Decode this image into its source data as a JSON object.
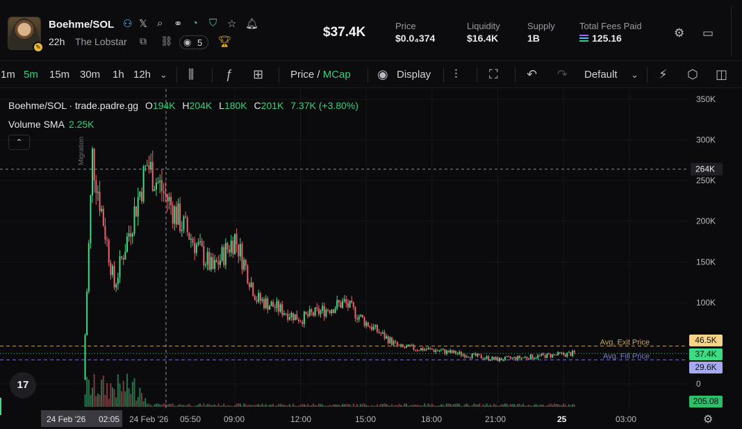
{
  "header": {
    "pair": "Boehme/SOL",
    "age": "22h",
    "creator": "The Lobstar",
    "watchers": "5",
    "market_cap": "$37.4K",
    "stats": [
      {
        "label": "Price",
        "value": "$0.0₄374"
      },
      {
        "label": "Liquidity",
        "value": "$16.4K"
      },
      {
        "label": "Supply",
        "value": "1B"
      },
      {
        "label": "Total Fees Paid",
        "value": "125.16"
      }
    ],
    "icons": [
      "community-icon",
      "x-icon",
      "search-icon",
      "link-icon",
      "pie-icon",
      "shield-icon",
      "star-icon",
      "bell-icon",
      "copy-icon",
      "chain-icon",
      "eye-icon",
      "trophy-icon",
      "settings-icon",
      "layout-icon"
    ]
  },
  "toolbar": {
    "timeframes": [
      "1m",
      "5m",
      "15m",
      "30m",
      "1h",
      "12h"
    ],
    "active_timeframe": "5m",
    "price_label": "Price",
    "mcap_label": "MCap",
    "display_label": "Display",
    "template_label": "Default"
  },
  "legend": {
    "symbol": "Boehme/SOL · trade.padre.gg",
    "o_label": "O",
    "o": "194K",
    "h_label": "H",
    "h": "204K",
    "l_label": "L",
    "l": "180K",
    "c_label": "C",
    "c": "201K",
    "change": "7.37K (+3.80%)",
    "volume_label": "Volume SMA",
    "volume_value": "2.25K",
    "collapse": "⌃"
  },
  "chart_data": {
    "type": "candlestick",
    "series_unit": "market cap (USD)",
    "y_ticks": [
      "350K",
      "300K",
      "250K",
      "200K",
      "150K",
      "100K",
      "0"
    ],
    "x_ticks": [
      "24 Feb '26",
      "05:50",
      "09:00",
      "12:00",
      "15:00",
      "18:00",
      "21:00",
      "25",
      "03:00"
    ],
    "x_highlight": {
      "date": "24 Feb '26",
      "time": "02:05"
    },
    "ylim": [
      0,
      350000
    ],
    "crosshair_level": "264K",
    "price_lines": [
      {
        "label": "Avg. Exit Price",
        "value": "46.5K",
        "color": "#e8c36a"
      },
      {
        "label": "Avg. Fill Price",
        "value": "29.6K",
        "color": "#8a8ef0"
      }
    ],
    "current_value": "37.4K",
    "volume_badge": "205.08",
    "migration_label": "Migration",
    "trend": [
      {
        "time": "02:05",
        "mcap": 5000
      },
      {
        "time": "02:30",
        "mcap": 280000
      },
      {
        "time": "03:30",
        "mcap": 120000
      },
      {
        "time": "05:00",
        "mcap": 270000
      },
      {
        "time": "06:30",
        "mcap": 200000
      },
      {
        "time": "08:00",
        "mcap": 140000
      },
      {
        "time": "09:00",
        "mcap": 180000
      },
      {
        "time": "10:00",
        "mcap": 105000
      },
      {
        "time": "12:00",
        "mcap": 80000
      },
      {
        "time": "14:00",
        "mcap": 100000
      },
      {
        "time": "15:00",
        "mcap": 75000
      },
      {
        "time": "16:30",
        "mcap": 45000
      },
      {
        "time": "18:00",
        "mcap": 42000
      },
      {
        "time": "21:00",
        "mcap": 30000
      },
      {
        "time": "25 00:30",
        "mcap": 37400
      }
    ]
  }
}
